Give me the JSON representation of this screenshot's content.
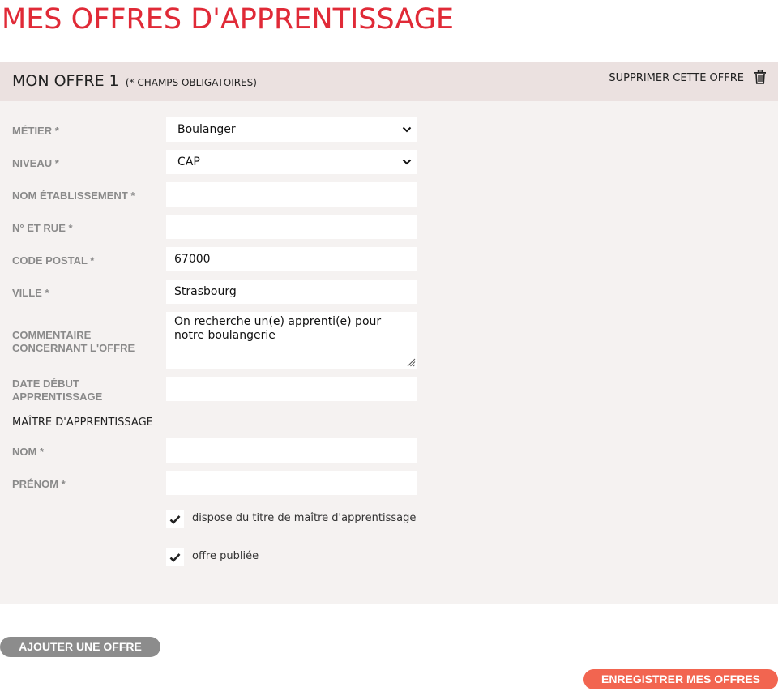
{
  "page": {
    "title": "MES OFFRES D'APPRENTISSAGE"
  },
  "offer": {
    "title": "MON OFFRE 1",
    "required_note": "(* CHAMPS OBLIGATOIRES)",
    "delete_label": "SUPPRIMER CETTE OFFRE",
    "fields": {
      "metier": {
        "label": "MÉTIER *",
        "value": "Boulanger"
      },
      "niveau": {
        "label": "NIVEAU *",
        "value": "CAP"
      },
      "nom_etablissement": {
        "label": "NOM ÉTABLISSEMENT *",
        "value": ""
      },
      "rue": {
        "label": "N° ET RUE *",
        "value": ""
      },
      "code_postal": {
        "label": "CODE POSTAL *",
        "value": "67000"
      },
      "ville": {
        "label": "VILLE *",
        "value": "Strasbourg"
      },
      "commentaire": {
        "label": "COMMENTAIRE CONCERNANT L'OFFRE",
        "value": "On recherche un(e) apprenti(e) pour notre boulangerie"
      },
      "date_debut": {
        "label": "DATE DÉBUT APPRENTISSAGE",
        "value": ""
      }
    },
    "maitre": {
      "section_label": "MAÎTRE D'APPRENTISSAGE",
      "nom": {
        "label": "NOM *",
        "value": ""
      },
      "prenom": {
        "label": "PRÉNOM *",
        "value": ""
      }
    },
    "checkboxes": {
      "titre_maitre": {
        "label": "dispose du titre de maître d'apprentissage",
        "checked": true
      },
      "publiee": {
        "label": "offre publiée",
        "checked": true
      }
    }
  },
  "actions": {
    "add_label": "AJOUTER UNE OFFRE",
    "save_label": "ENREGISTRER MES OFFRES"
  },
  "colors": {
    "title_red": "#e02a37",
    "save_orange": "#f26550",
    "add_gray": "#8c8c8c"
  }
}
